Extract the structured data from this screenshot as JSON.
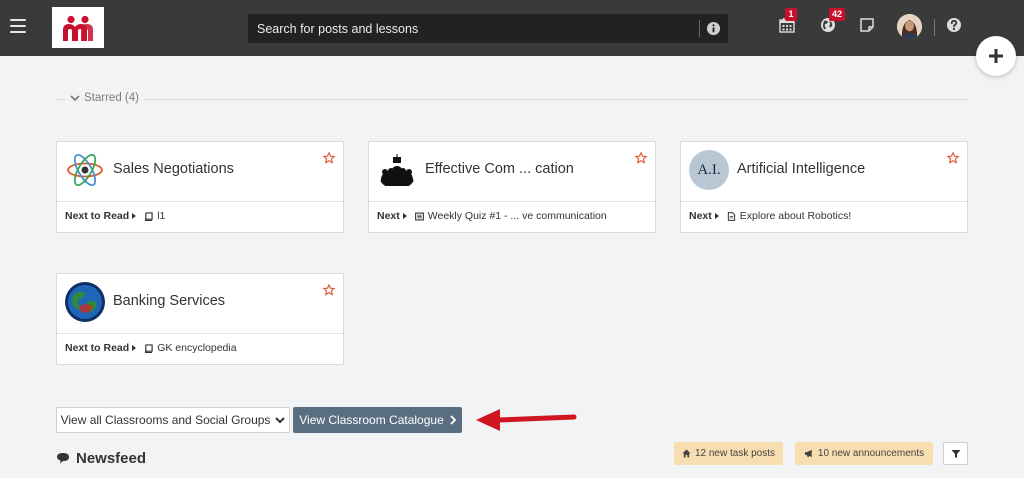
{
  "header": {
    "search_placeholder": "Search for posts and lessons",
    "calendar_badge": "1",
    "globe_badge": "42"
  },
  "starred": {
    "label": "Starred (4)",
    "cards": [
      {
        "title": "Sales Negotiations",
        "next_label": "Next to Read",
        "next_item": "l1",
        "item_icon": "book-icon"
      },
      {
        "title": "Effective Com ... cation",
        "next_label": "Next",
        "next_item": "Weekly Quiz #1 - ... ve communication",
        "item_icon": "quiz-icon"
      },
      {
        "title": "Artificial Intelligence",
        "next_label": "Next",
        "next_item": "Explore about Robotics!",
        "item_icon": "document-icon",
        "thumb_text": "A.I."
      },
      {
        "title": "Banking Services",
        "next_label": "Next to Read",
        "next_item": "GK encyclopedia",
        "item_icon": "book-icon"
      }
    ]
  },
  "actions": {
    "view_all": "View all Classrooms and Social Groups",
    "view_catalogue": "View Classroom Catalogue"
  },
  "newsfeed": {
    "title": "Newsfeed",
    "task_posts": "12 new task posts",
    "announcements": "10 new announcements"
  },
  "colors": {
    "topbar": "#3a3a3a",
    "badge": "#c8102e",
    "catalogue_button": "#5a6e82",
    "pill": "#f8ddb0",
    "annotation_arrow": "#d0161e",
    "star": "#e0542c"
  }
}
